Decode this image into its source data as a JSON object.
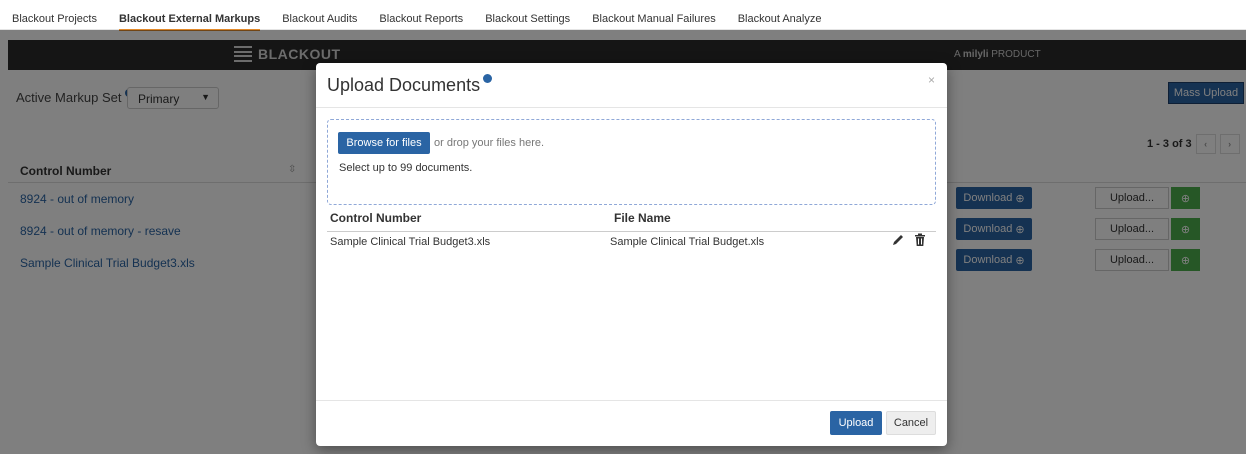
{
  "tabs": [
    {
      "label": "Blackout Projects"
    },
    {
      "label": "Blackout External Markups"
    },
    {
      "label": "Blackout Audits"
    },
    {
      "label": "Blackout Reports"
    },
    {
      "label": "Blackout Settings"
    },
    {
      "label": "Blackout Manual Failures"
    },
    {
      "label": "Blackout Analyze"
    }
  ],
  "active_tab_index": 1,
  "header": {
    "logo_text": "BLACKOUT",
    "product_prefix": "A ",
    "product_brand": "milyli",
    "product_suffix": " PRODUCT"
  },
  "toolbar": {
    "markup_label": "Active Markup Set",
    "markup_value": "Primary",
    "mass_upload_label": "Mass Upload"
  },
  "pager": {
    "text": "1 - 3 of 3"
  },
  "table": {
    "header_control": "Control Number",
    "rows": [
      {
        "control": "8924 - out of memory",
        "download": "Download",
        "upload": "Upload..."
      },
      {
        "control": "8924 - out of memory - resave",
        "download": "Download",
        "upload": "Upload..."
      },
      {
        "control": "Sample Clinical Trial Budget3.xls",
        "download": "Download",
        "upload": "Upload..."
      }
    ]
  },
  "modal": {
    "title": "Upload Documents",
    "close": "×",
    "browse_label": "Browse for files",
    "drop_text": "or drop your files here.",
    "limit_text": "Select up to 99 documents.",
    "col_control": "Control Number",
    "col_file": "File Name",
    "files": [
      {
        "control": "Sample Clinical Trial Budget3.xls",
        "file": "Sample Clinical Trial Budget.xls"
      }
    ],
    "upload_label": "Upload",
    "cancel_label": "Cancel"
  },
  "colors": {
    "accent": "#2a64a4",
    "active_tab_underline": "#e28a2b",
    "success": "#4cae4c",
    "banner": "#2b2b2b"
  }
}
